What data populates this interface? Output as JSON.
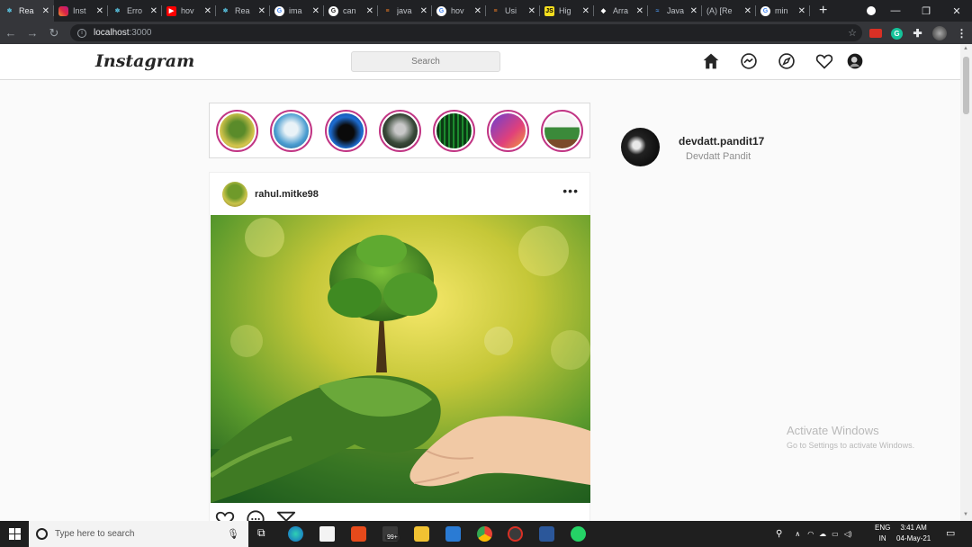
{
  "browser": {
    "tabs": [
      {
        "label": "Rea",
        "icon": "react-icon",
        "color": "#61dafb",
        "active": true
      },
      {
        "label": "Inst",
        "icon": "instagram-icon",
        "color": "#e1306c"
      },
      {
        "label": "Erro",
        "icon": "react-icon",
        "color": "#61dafb"
      },
      {
        "label": "hov",
        "icon": "youtube-icon",
        "color": "#ff0000"
      },
      {
        "label": "Rea",
        "icon": "react-icon",
        "color": "#61dafb"
      },
      {
        "label": "ima",
        "icon": "google-icon",
        "color": "#ffffff"
      },
      {
        "label": "can",
        "icon": "grammarly-icon",
        "color": "#ffffff"
      },
      {
        "label": "java",
        "icon": "stackoverflow-icon",
        "color": "#f48024"
      },
      {
        "label": "hov",
        "icon": "google-icon",
        "color": "#ffffff"
      },
      {
        "label": "Usi",
        "icon": "stackoverflow-icon",
        "color": "#f48024"
      },
      {
        "label": "Hig",
        "icon": "js-icon",
        "color": "#f7df1e"
      },
      {
        "label": "Arra",
        "icon": "devicon-icon",
        "color": "#ffffff"
      },
      {
        "label": "Java",
        "icon": "w3-icon",
        "color": "#4a90e2"
      },
      {
        "label": "(A) [Re",
        "icon": "",
        "color": ""
      },
      {
        "label": "min",
        "icon": "google-icon",
        "color": "#ffffff"
      }
    ],
    "new_tab": "+",
    "url_host": "localhost",
    "url_port": ":3000"
  },
  "header": {
    "logo": "Instagram",
    "search_placeholder": "Search"
  },
  "post": {
    "username": "rahul.mitke98",
    "more": "•••"
  },
  "profile": {
    "username": "devdatt.pandit17",
    "full_name": "Devdatt Pandit"
  },
  "watermark": {
    "title": "Activate Windows",
    "subtitle": "Go to Settings to activate Windows."
  },
  "taskbar": {
    "search_placeholder": "Type here to search",
    "badge": "99+",
    "lang_top": "ENG",
    "lang_bottom": "IN",
    "time": "3:41 AM",
    "date": "04-May-21"
  },
  "colors": {
    "story_ring": "#c13584",
    "border": "#dbdbdb",
    "text": "#262626",
    "muted": "#8e8e8e"
  }
}
